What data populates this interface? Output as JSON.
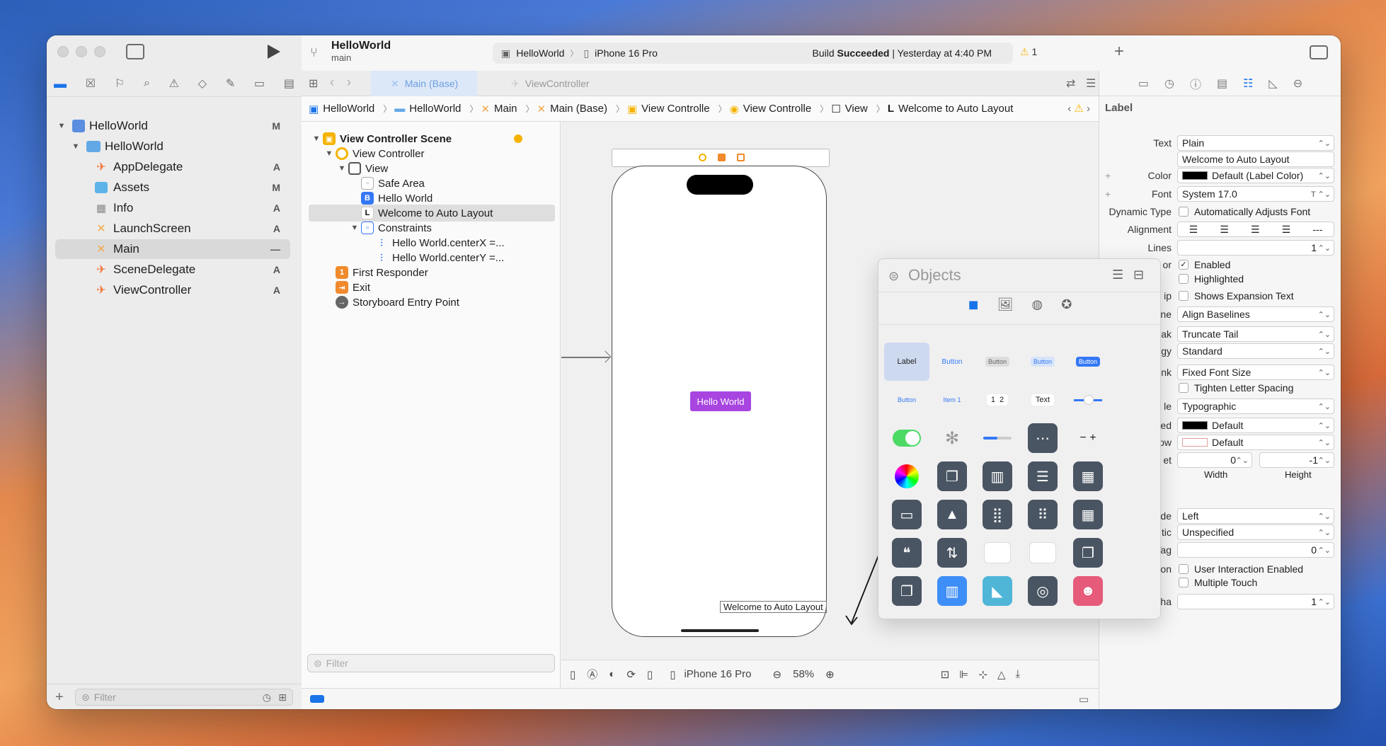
{
  "project": {
    "name": "HelloWorld",
    "branch": "main"
  },
  "scheme": {
    "target": "HelloWorld",
    "device": "iPhone 16 Pro"
  },
  "status": {
    "prefix": "Build ",
    "bold": "Succeeded",
    "suffix": " | Yesterday at 4:40 PM",
    "warnings": "1"
  },
  "tabs": [
    {
      "label": "Main (Base)"
    },
    {
      "label": "ViewController"
    }
  ],
  "jumpbar": [
    "HelloWorld",
    "HelloWorld",
    "Main",
    "Main (Base)",
    "View Controlle",
    "View Controlle",
    "View",
    "Welcome to Auto Layout"
  ],
  "navigator": {
    "items": [
      {
        "label": "HelloWorld",
        "badge": "M"
      },
      {
        "label": "HelloWorld",
        "badge": ""
      },
      {
        "label": "AppDelegate",
        "badge": "A"
      },
      {
        "label": "Assets",
        "badge": "M"
      },
      {
        "label": "Info",
        "badge": "A"
      },
      {
        "label": "LaunchScreen",
        "badge": "A"
      },
      {
        "label": "Main",
        "badge": "—"
      },
      {
        "label": "SceneDelegate",
        "badge": "A"
      },
      {
        "label": "ViewController",
        "badge": "A"
      }
    ],
    "filter_placeholder": "Filter"
  },
  "outline": {
    "items": [
      "View Controller Scene",
      "View Controller",
      "View",
      "Safe Area",
      "Hello World",
      "Welcome to Auto Layout",
      "Constraints",
      "Hello World.centerX =...",
      "Hello World.centerY =...",
      "First Responder",
      "Exit",
      "Storyboard Entry Point"
    ],
    "filter_placeholder": "Filter"
  },
  "canvas": {
    "button_label": "Hello World",
    "label_text": "Welcome to Auto Layout",
    "device": "iPhone 16 Pro",
    "zoom": "58%"
  },
  "objects": {
    "title": "Objects",
    "row1": [
      "Label",
      "Button",
      "Button",
      "Button",
      "Button"
    ],
    "row2": [
      "Button",
      "Item 1",
      "1  2",
      "Text",
      ""
    ]
  },
  "inspector": {
    "section": "Label",
    "text_type": "Plain",
    "text_value": "Welcome to Auto Layout",
    "color": "Default (Label Color)",
    "font": "System 17.0",
    "dynamic_type": "Automatically Adjusts Font",
    "lines": "1",
    "enabled": "Enabled",
    "highlighted": "Highlighted",
    "expansion": "Shows Expansion Text",
    "baseline": "Align Baselines",
    "line_break": "Truncate Tail",
    "strategy": "Standard",
    "autoshrink": "Fixed Font Size",
    "tighten": "Tighten Letter Spacing",
    "capitalization": "Typographic",
    "highlighted_color": "Default",
    "shadow_color": "Default",
    "offset_width": "0",
    "offset_height": "-1",
    "width_label": "Width",
    "height_label": "Height",
    "mode": "Left",
    "semantic": "Unspecified",
    "tag_label": "Tag",
    "tag": "0",
    "interaction_label": "Interaction",
    "user_interaction": "User Interaction Enabled",
    "multiple_touch": "Multiple Touch",
    "alpha_label": "Alpha",
    "alpha": "1",
    "labels": {
      "text": "Text",
      "color": "Color",
      "font": "Font",
      "dynamic": "Dynamic Type",
      "alignment": "Alignment",
      "lines": "Lines",
      "behavior": "or",
      "tip": "ip",
      "baseline": "ne",
      "break": "ak",
      "strategy": "gy",
      "autoshrink": "nk",
      "caps": "le",
      "highlighted": "ed",
      "shadow": "ow",
      "offset": "et",
      "mode": "de",
      "semantic": "tic"
    }
  },
  "colors": {
    "accent": "#1a73e8",
    "button_purple": "#a845e0",
    "warning": "#f5b300",
    "swift": "#f0783c"
  }
}
